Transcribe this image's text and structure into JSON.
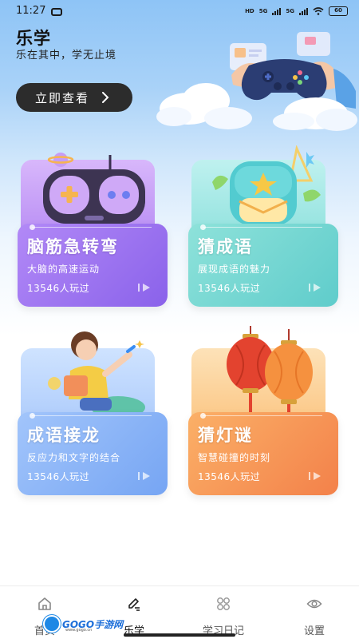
{
  "status_bar": {
    "time": "11:27",
    "net_tag": "HD",
    "sig1_tag": "5G",
    "sig2_tag": "5G",
    "battery": "60"
  },
  "header": {
    "title": "乐学",
    "subtitle": "乐在其中，学无止境",
    "button_label": "立即查看"
  },
  "cards": [
    {
      "title": "脑筋急转弯",
      "desc": "大脑的高速运动",
      "count": "13546人玩过"
    },
    {
      "title": "猜成语",
      "desc": "展现成语的魅力",
      "count": "13546人玩过"
    },
    {
      "title": "成语接龙",
      "desc": "反应力和文字的结合",
      "count": "13546人玩过"
    },
    {
      "title": "猜灯谜",
      "desc": "智慧碰撞的时刻",
      "count": "13546人玩过"
    }
  ],
  "nav": [
    {
      "label": "首页",
      "icon": "home-icon"
    },
    {
      "label": "乐学",
      "icon": "pen-icon"
    },
    {
      "label": "学习日记",
      "icon": "grid-icon"
    },
    {
      "label": "设置",
      "icon": "eye-icon"
    }
  ],
  "watermark": {
    "text": "GOGO手游网",
    "sub": "www.gogo.cn"
  },
  "colors": {
    "purple": "#8a62ea",
    "teal": "#5fcccb",
    "blue": "#76a5f3",
    "orange": "#f3814a",
    "button": "#2c2c2c"
  }
}
